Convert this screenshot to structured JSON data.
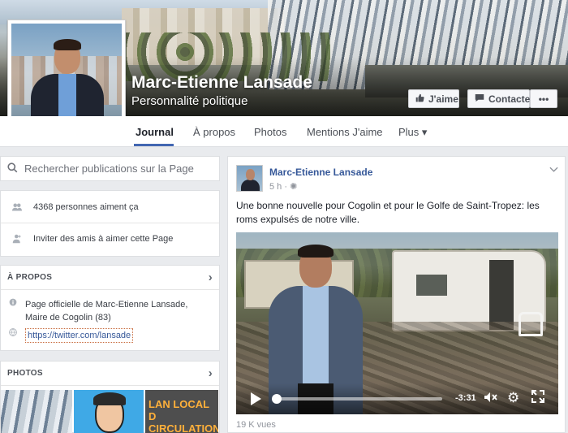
{
  "page": {
    "name": "Marc-Etienne Lansade",
    "category": "Personnalité politique"
  },
  "actions": {
    "like_label": "J'aime",
    "contact_label": "Contacter",
    "more_label": "•••"
  },
  "nav": {
    "tabs": [
      {
        "label": "Journal"
      },
      {
        "label": "À propos"
      },
      {
        "label": "Photos"
      },
      {
        "label": "Mentions J'aime"
      },
      {
        "label": "Plus ▾"
      }
    ]
  },
  "sidebar": {
    "search_placeholder": "Rechercher publications sur la Page",
    "likes_text": "4368 personnes aiment ça",
    "invite_text": "Inviter des amis à aimer cette Page",
    "about": {
      "title": "À PROPOS",
      "description": "Page officielle de Marc-Etienne Lansade, Maire de Cogolin (83)",
      "link": "https://twitter.com/lansade"
    },
    "photos": {
      "title": "PHOTOS",
      "thumb3_text": "LAN LOCAL D CIRCULATION ET DE"
    }
  },
  "post": {
    "author": "Marc-Etienne Lansade",
    "time": "5 h",
    "text": "Une bonne nouvelle pour Cogolin et pour le Golfe de Saint-Tropez: les roms expulsés de notre ville.",
    "video": {
      "time_remaining": "-3:31",
      "progress": 0.0
    },
    "views": "19 K vues"
  },
  "icons": {
    "search": "search-icon",
    "people": "people-icon",
    "invite": "invite-icon",
    "info": "info-icon",
    "globe": "globe-icon"
  },
  "colors": {
    "link_blue": "#365899",
    "nav_active_underline": "#4267b2",
    "page_bg": "#e9ebee"
  }
}
